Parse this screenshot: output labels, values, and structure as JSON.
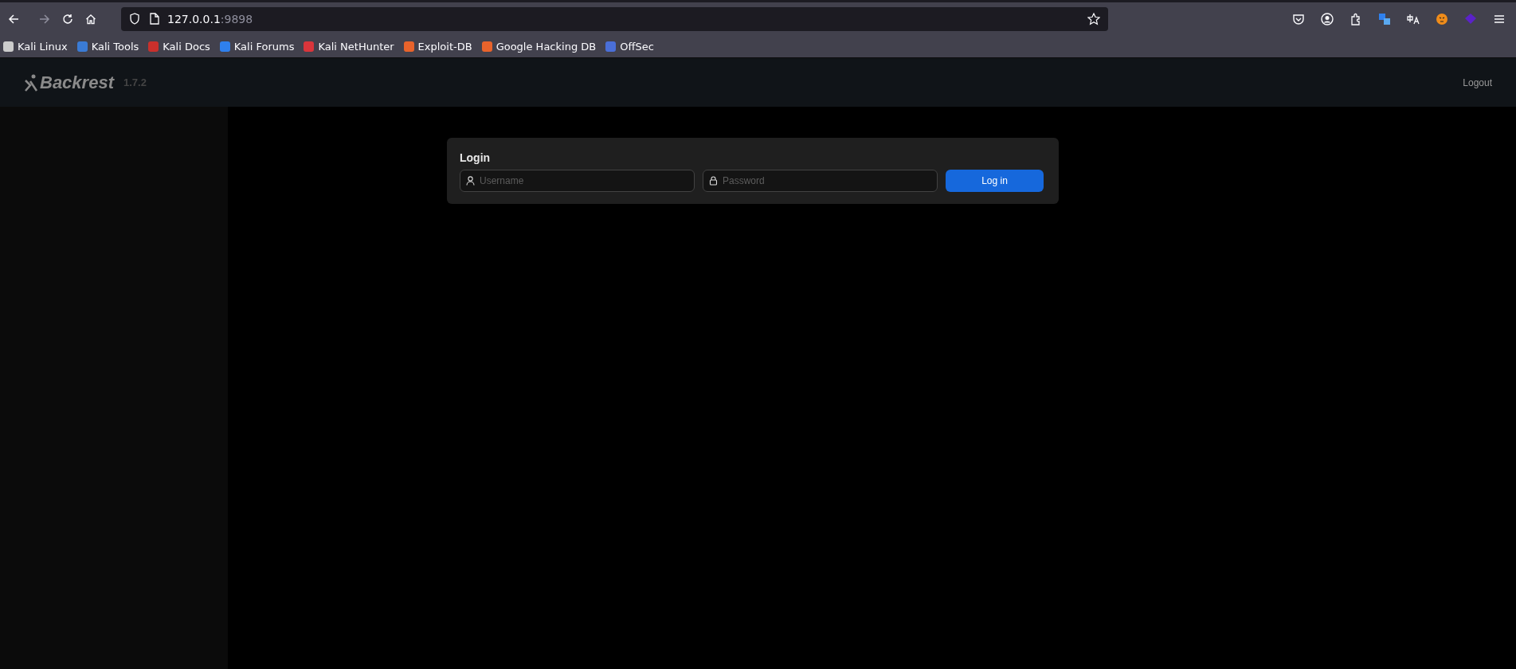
{
  "browser": {
    "url_host": "127.0.0.1",
    "url_port": ":9898",
    "bookmarks": [
      {
        "label": "Kali Linux",
        "color": "#cccccc"
      },
      {
        "label": "Kali Tools",
        "color": "#3a7bd5"
      },
      {
        "label": "Kali Docs",
        "color": "#c9302c"
      },
      {
        "label": "Kali Forums",
        "color": "#2f80ed"
      },
      {
        "label": "Kali NetHunter",
        "color": "#d9353b"
      },
      {
        "label": "Exploit-DB",
        "color": "#e8632b"
      },
      {
        "label": "Google Hacking DB",
        "color": "#e8632b"
      },
      {
        "label": "OffSec",
        "color": "#4a6fd8"
      }
    ]
  },
  "app": {
    "logo": "Backrest",
    "version": "1.7.2",
    "logout": "Logout"
  },
  "login": {
    "title": "Login",
    "username_placeholder": "Username",
    "password_placeholder": "Password",
    "submit": "Log in"
  }
}
